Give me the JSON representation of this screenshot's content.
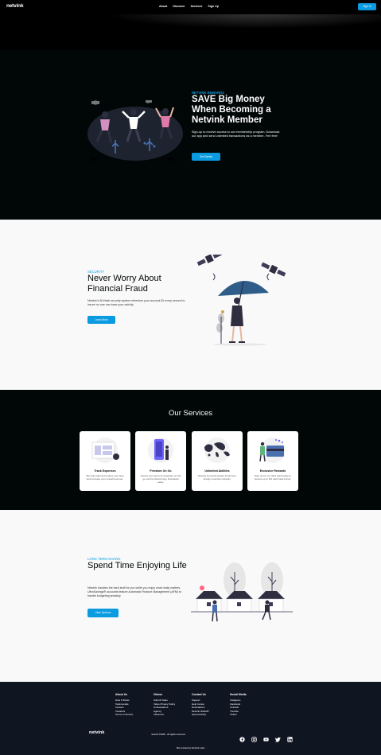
{
  "nav": {
    "logo": "netvink",
    "links": [
      "About",
      "Discover",
      "Services",
      "Sign Up"
    ],
    "signin": "Sign In"
  },
  "rewards": {
    "kicker": "NETVINK REWARDS",
    "title": "SAVE Big Money When Becoming a Netvink Member",
    "desc": "Sign-up to receive access to our membership program. Download our app and send unlimited transactions as a member- Fee free!",
    "cta": "Get Started"
  },
  "security": {
    "kicker": "SECURITY",
    "title": "Never Worry About Financial Fraud",
    "desc": "Netvink's Bi-Hash security system refreshes your account ID every second to insure no one can trace your activity.",
    "cta": "Learn More"
  },
  "services": {
    "heading": "Our Services",
    "cards": [
      {
        "title": "Track Expenses",
        "desc": "We help track and reduce your fees and increase your overall revenue."
      },
      {
        "title": "Freedom On Go",
        "desc": "Access your account anywhere on the go via the Netvink App. Download today."
      },
      {
        "title": "Unlimited Abilities",
        "desc": "Directly send and accept funds from foreign countries instantly."
      },
      {
        "title": "Exclusive Rewards",
        "desc": "Sign up for our Ultra Card today to receive up to 9% cash back bonus."
      }
    ]
  },
  "longterm": {
    "kicker": "LONG TERM SAVING",
    "title": "Spend Time Enjoying Life",
    "desc": "Netvink handles the hard stuff for you while you enjoy what really matters. UltraSavings® accounts feature Automatic Finance Management (AFM) to handle budgeting sneakily.",
    "cta": "View Options"
  },
  "footer": {
    "columns": [
      {
        "heading": "About Us",
        "links": [
          "How it Works",
          "Testimonials",
          "Careers",
          "Investors",
          "Terms of Service"
        ]
      },
      {
        "heading": "Videos",
        "links": [
          "Submit Video",
          "Video Privacy Policy",
          "Ambassadors",
          "Agency",
          "Influencer"
        ]
      },
      {
        "heading": "Contact Us",
        "links": [
          "Support",
          "Help Center",
          "Destinations",
          "Netvink Global©",
          "Sponsorships"
        ]
      },
      {
        "heading": "Social Media",
        "links": [
          "Instagram",
          "Facebook",
          "LinkedIn",
          "Youtube",
          "Twitter"
        ]
      }
    ],
    "logo": "netvink",
    "rights": "netvink ©2020 . All rights reserved.",
    "credit": "Site created by Netvink Labs",
    "social_icons": [
      "facebook-icon",
      "instagram-icon",
      "youtube-icon",
      "twitter-icon",
      "linkedin-icon"
    ]
  },
  "colors": {
    "accent": "#0b9be0",
    "dark": "#010606",
    "light": "#f9f9f9",
    "footer": "#101522"
  }
}
